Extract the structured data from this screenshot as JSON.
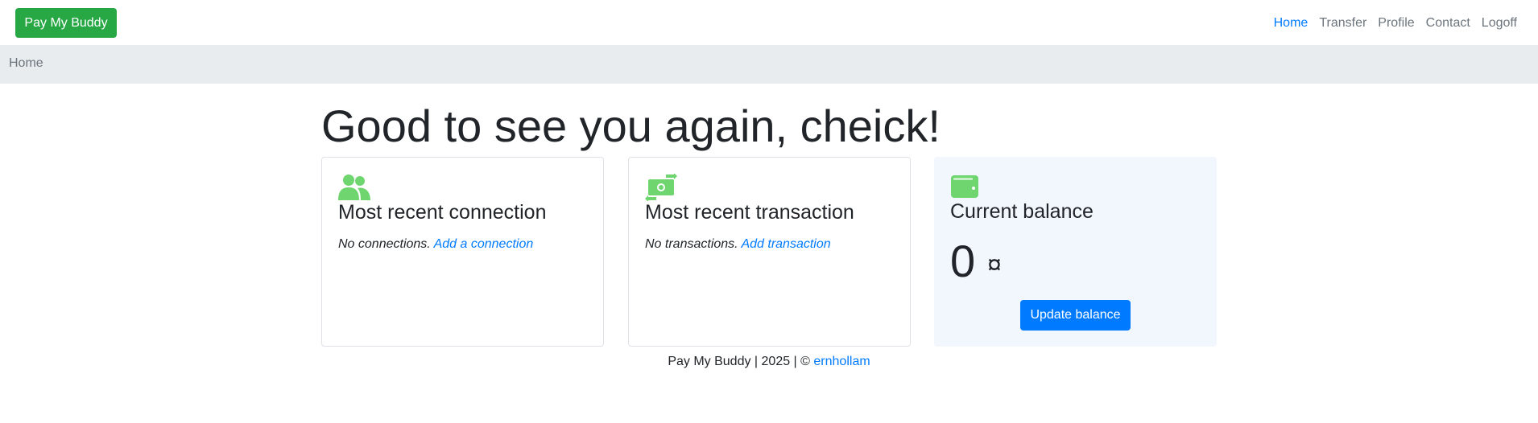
{
  "nav": {
    "brand": "Pay My Buddy",
    "links": [
      "Home",
      "Transfer",
      "Profile",
      "Contact",
      "Logoff"
    ],
    "active": "Home"
  },
  "breadcrumb": {
    "current": "Home"
  },
  "greeting": "Good to see you again, cheick!",
  "cards": {
    "connection": {
      "icon": "users-icon",
      "title": "Most recent connection",
      "empty_text": "No connections.",
      "link": "Add a connection"
    },
    "transaction": {
      "icon": "money-transfer-icon",
      "title": "Most recent transaction",
      "empty_text": "No transactions.",
      "link": "Add transaction"
    },
    "balance": {
      "icon": "wallet-icon",
      "title": "Current balance",
      "amount": "0",
      "currency": "¤",
      "button": "Update balance"
    }
  },
  "footer": {
    "text": "Pay My Buddy | 2025 | ©",
    "author": "ernhollam"
  },
  "colors": {
    "brand": "#28a745",
    "primary": "#007bff",
    "icon_green": "#6fd66f",
    "breadcrumb_bg": "#e9ecef",
    "balance_bg": "#f2f6fd"
  }
}
